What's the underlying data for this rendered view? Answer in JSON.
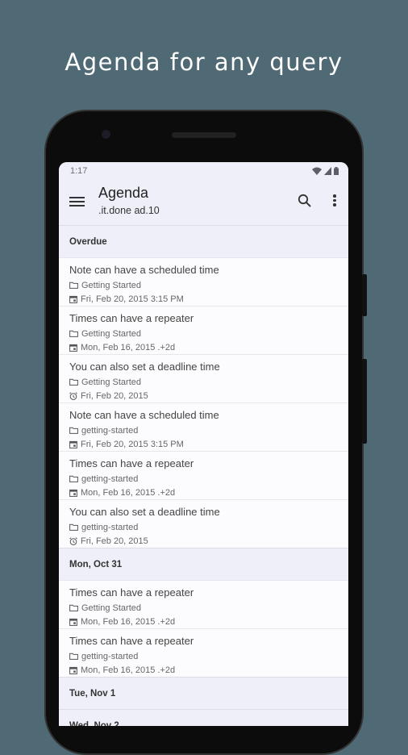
{
  "headline": "Agenda for any query",
  "status": {
    "time": "1:17"
  },
  "appbar": {
    "title": "Agenda",
    "subtitle": ".it.done ad.10"
  },
  "sections": [
    {
      "label": "Overdue",
      "items": [
        {
          "title": "Note can have a scheduled time",
          "book": "Getting Started",
          "time": "Fri, Feb 20, 2015 3:15 PM",
          "time_icon": "calendar-icon"
        },
        {
          "title": "Times can have a repeater",
          "book": "Getting Started",
          "time": "Mon, Feb 16, 2015 .+2d",
          "time_icon": "calendar-icon"
        },
        {
          "title": "You can also set a deadline time",
          "book": "Getting Started",
          "time": "Fri, Feb 20, 2015",
          "time_icon": "alarm-icon"
        },
        {
          "title": "Note can have a scheduled time",
          "book": "getting-started",
          "time": "Fri, Feb 20, 2015 3:15 PM",
          "time_icon": "calendar-icon"
        },
        {
          "title": "Times can have a repeater",
          "book": "getting-started",
          "time": "Mon, Feb 16, 2015 .+2d",
          "time_icon": "calendar-icon"
        },
        {
          "title": "You can also set a deadline time",
          "book": "getting-started",
          "time": "Fri, Feb 20, 2015",
          "time_icon": "alarm-icon"
        }
      ]
    },
    {
      "label": "Mon, Oct 31",
      "items": [
        {
          "title": "Times can have a repeater",
          "book": "Getting Started",
          "time": "Mon, Feb 16, 2015 .+2d",
          "time_icon": "calendar-icon"
        },
        {
          "title": "Times can have a repeater",
          "book": "getting-started",
          "time": "Mon, Feb 16, 2015 .+2d",
          "time_icon": "calendar-icon"
        }
      ]
    },
    {
      "label": "Tue, Nov 1",
      "items": []
    },
    {
      "label": "Wed, Nov 2",
      "items": []
    }
  ],
  "colors": {
    "background": "#4f6a74",
    "appbar": "#eeeff8",
    "item": "#fcfcfe"
  }
}
